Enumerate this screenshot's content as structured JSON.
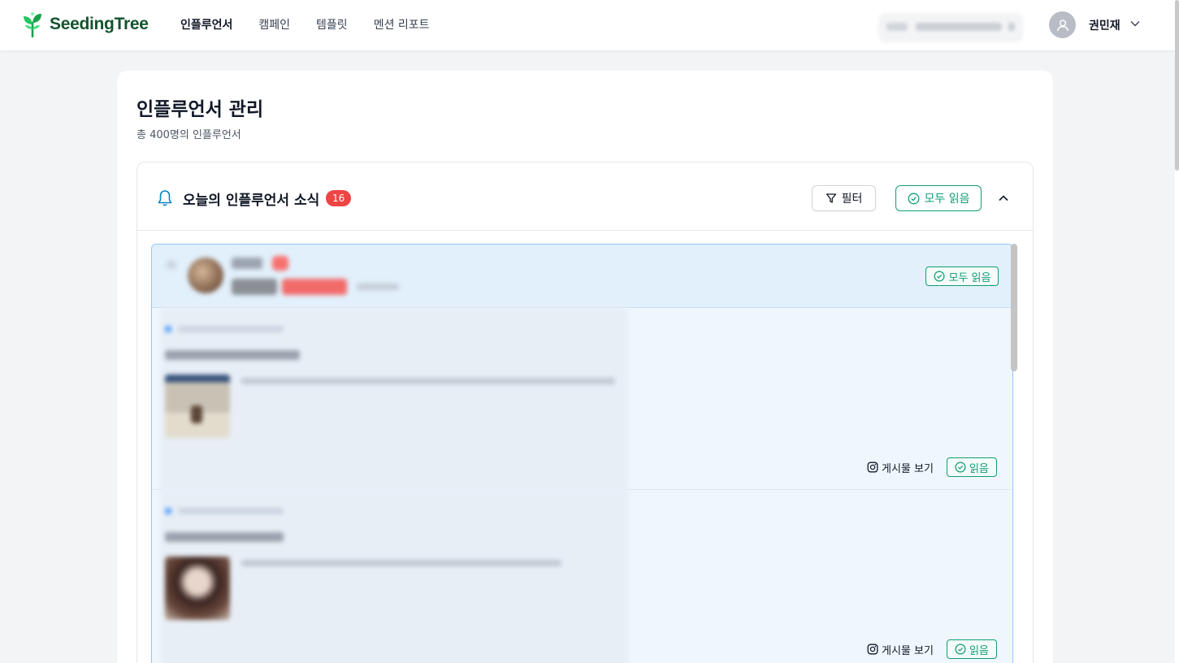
{
  "brand": {
    "name": "SeedingTree",
    "color": "#14532d",
    "accent": "#0f9d74"
  },
  "nav": [
    {
      "label": "인플루언서",
      "active": true
    },
    {
      "label": "캠페인",
      "active": false
    },
    {
      "label": "템플릿",
      "active": false
    },
    {
      "label": "멘션 리포트",
      "active": false
    }
  ],
  "user": {
    "name": "권민재"
  },
  "page": {
    "title": "인플루언서 관리",
    "subtitle": "총 400명의 인플루언서"
  },
  "news": {
    "title": "오늘의 인플루언서 소식",
    "count": "16",
    "filter_label": "필터",
    "read_all_label": "모두 읽음",
    "group": {
      "read_all_label": "모두 읽음"
    },
    "items": [
      {
        "view_label": "게시물 보기",
        "read_label": "읽음"
      },
      {
        "view_label": "게시물 보기",
        "read_label": "읽음"
      }
    ]
  }
}
